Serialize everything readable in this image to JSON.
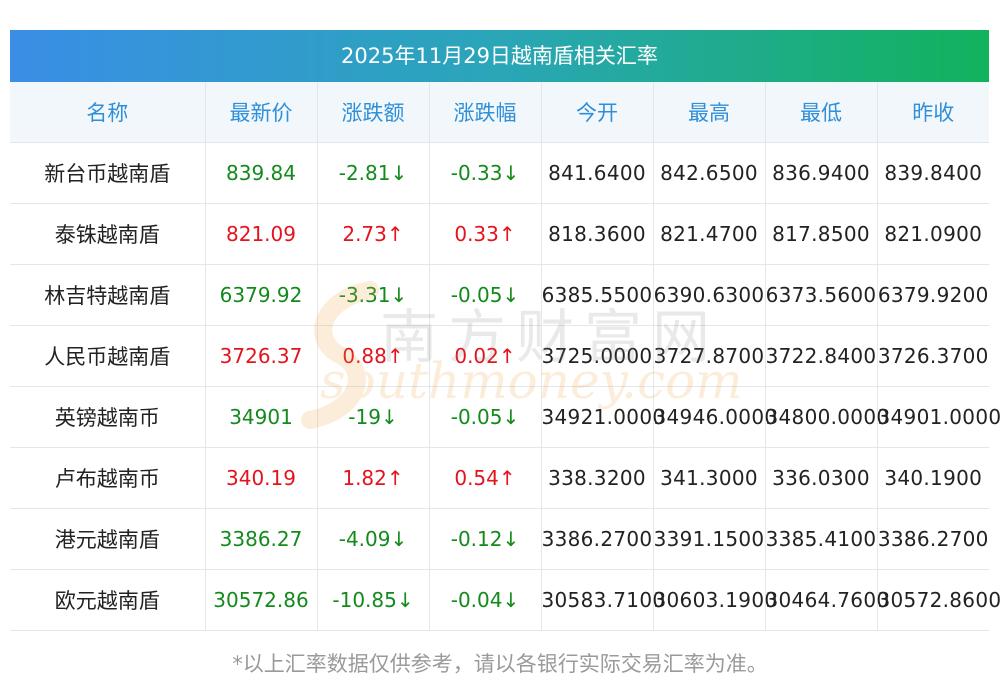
{
  "title": "2025年11月29日越南盾相关汇率",
  "headers": [
    "名称",
    "最新价",
    "涨跌额",
    "涨跌幅",
    "今开",
    "最高",
    "最低",
    "昨收"
  ],
  "rows": [
    {
      "name": "新台币越南盾",
      "latest": "839.84",
      "change": "-2.81↓",
      "pct": "-0.33↓",
      "open": "841.6400",
      "high": "842.6500",
      "low": "836.9400",
      "prev": "839.8400",
      "dir": "down"
    },
    {
      "name": "泰铢越南盾",
      "latest": "821.09",
      "change": "2.73↑",
      "pct": "0.33↑",
      "open": "818.3600",
      "high": "821.4700",
      "low": "817.8500",
      "prev": "821.0900",
      "dir": "up"
    },
    {
      "name": "林吉特越南盾",
      "latest": "6379.92",
      "change": "-3.31↓",
      "pct": "-0.05↓",
      "open": "6385.5500",
      "high": "6390.6300",
      "low": "6373.5600",
      "prev": "6379.9200",
      "dir": "down"
    },
    {
      "name": "人民币越南盾",
      "latest": "3726.37",
      "change": "0.88↑",
      "pct": "0.02↑",
      "open": "3725.0000",
      "high": "3727.8700",
      "low": "3722.8400",
      "prev": "3726.3700",
      "dir": "up"
    },
    {
      "name": "英镑越南币",
      "latest": "34901",
      "change": "-19↓",
      "pct": "-0.05↓",
      "open": "34921.0000",
      "high": "34946.0000",
      "low": "34800.0000",
      "prev": "34901.0000",
      "dir": "down"
    },
    {
      "name": "卢布越南币",
      "latest": "340.19",
      "change": "1.82↑",
      "pct": "0.54↑",
      "open": "338.3200",
      "high": "341.3000",
      "low": "336.0300",
      "prev": "340.1900",
      "dir": "up"
    },
    {
      "name": "港元越南盾",
      "latest": "3386.27",
      "change": "-4.09↓",
      "pct": "-0.12↓",
      "open": "3386.2700",
      "high": "3391.1500",
      "low": "3385.4100",
      "prev": "3386.2700",
      "dir": "down"
    },
    {
      "name": "欧元越南盾",
      "latest": "30572.86",
      "change": "-10.85↓",
      "pct": "-0.04↓",
      "open": "30583.7100",
      "high": "30603.1900",
      "low": "30464.7600",
      "prev": "30572.8600",
      "dir": "down"
    }
  ],
  "colors": {
    "up": "#e3141e",
    "down": "#138a1c",
    "header_text": "#2f8fd8"
  },
  "watermark": {
    "cn": "南方财富网",
    "en": "southmoney.com"
  },
  "note": "*以上汇率数据仅供参考，请以各银行实际交易汇率为准。"
}
